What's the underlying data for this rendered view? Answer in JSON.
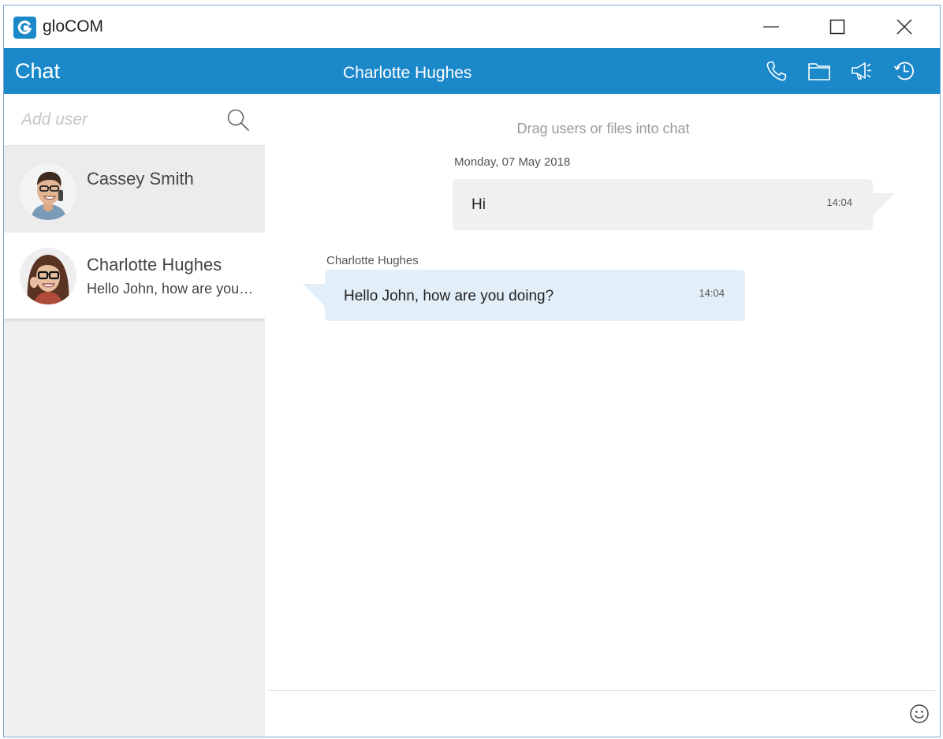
{
  "window": {
    "app_name": "gloCOM",
    "controls": {
      "minimize": "minimize-icon",
      "maximize": "maximize-icon",
      "close": "close-icon"
    }
  },
  "header": {
    "section_title": "Chat",
    "active_contact": "Charlotte Hughes",
    "icons": [
      "phone-icon",
      "folder-icon",
      "announcement-icon",
      "history-icon"
    ]
  },
  "sidebar": {
    "search": {
      "placeholder": "Add user",
      "value": ""
    },
    "contacts": [
      {
        "name": "Cassey Smith",
        "preview": ""
      },
      {
        "name": "Charlotte Hughes",
        "preview": "Hello John, how are you doing?"
      }
    ]
  },
  "chat": {
    "drag_hint": "Drag users or files into chat",
    "date_separator": "Monday, 07 May 2018",
    "messages": [
      {
        "direction": "outgoing",
        "text": "Hi",
        "time": "14:04"
      },
      {
        "direction": "incoming",
        "sender": "Charlotte Hughes",
        "text": "Hello John, how are you doing?",
        "time": "14:04"
      }
    ],
    "composer": {
      "value": "",
      "emoji_icon": "smiley-icon"
    }
  },
  "colors": {
    "brand_blue": "#1a88c9",
    "incoming_bubble": "#e2eef8",
    "outgoing_bubble": "#f0f0f0",
    "sidebar_bg": "#f0f0f0"
  }
}
